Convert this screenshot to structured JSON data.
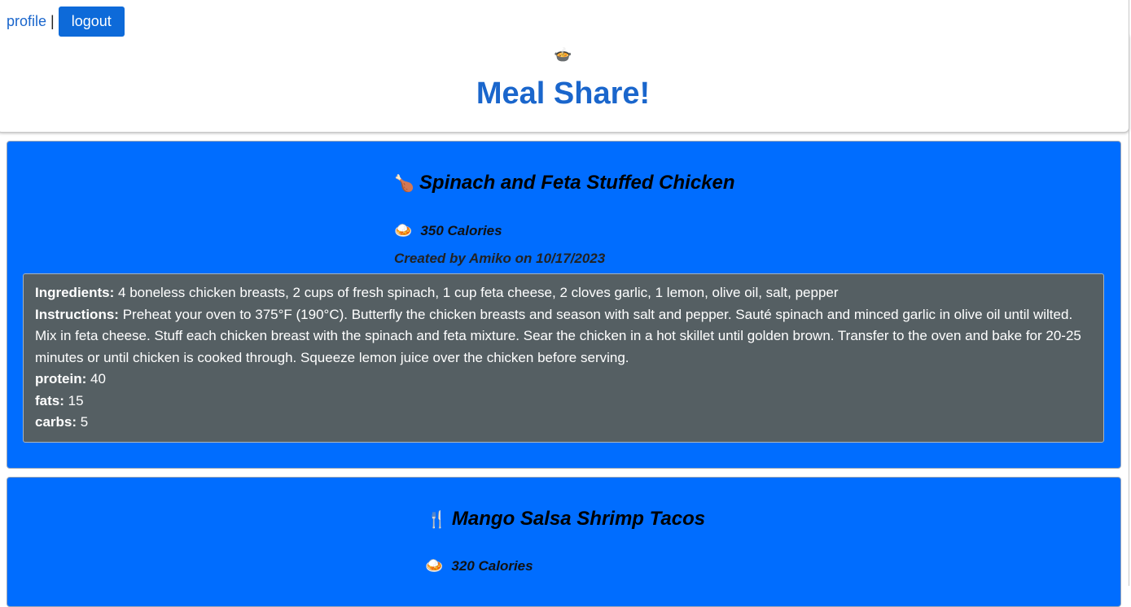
{
  "nav": {
    "profile_label": "profile",
    "separator": "|",
    "logout_label": "logout"
  },
  "header": {
    "icon": "🍲",
    "title": "Meal Share!"
  },
  "meals": [
    {
      "emoji": "🍗",
      "title": "Spinach and Feta Stuffed Chicken",
      "calorie_icon": "🍛",
      "calories": "350 Calories",
      "created": "Created by Amiko on 10/17/2023",
      "ingredients_label": "Ingredients:",
      "ingredients": "4 boneless chicken breasts, 2 cups of fresh spinach, 1 cup feta cheese, 2 cloves garlic, 1 lemon, olive oil, salt, pepper",
      "instructions_label": "Instructions:",
      "instructions": "Preheat your oven to 375°F (190°C). Butterfly the chicken breasts and season with salt and pepper. Sauté spinach and minced garlic in olive oil until wilted. Mix in feta cheese. Stuff each chicken breast with the spinach and feta mixture. Sear the chicken in a hot skillet until golden brown. Transfer to the oven and bake for 20-25 minutes or until chicken is cooked through. Squeeze lemon juice over the chicken before serving.",
      "protein_label": "protein:",
      "protein": "40",
      "fats_label": "fats:",
      "fats": "15",
      "carbs_label": "carbs:",
      "carbs": "5"
    },
    {
      "emoji": "🍴",
      "title": "Mango Salsa Shrimp Tacos",
      "calorie_icon": "🍛",
      "calories": "320 Calories"
    }
  ],
  "colors": {
    "card_blue": "#006dff",
    "details_gray": "#555f63",
    "link_blue": "#1a66cc"
  }
}
